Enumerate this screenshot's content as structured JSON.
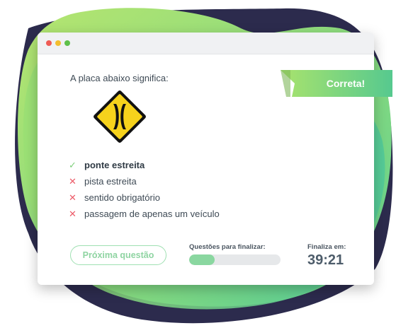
{
  "window": {
    "controls": [
      "close",
      "minimize",
      "maximize"
    ]
  },
  "quiz": {
    "question": "A placa abaixo significa:",
    "sign_icon": "narrow-bridge-sign-icon",
    "result_label": "Correta!",
    "options": [
      {
        "text": "ponte estreita",
        "status": "correct",
        "selected": true
      },
      {
        "text": "pista estreita",
        "status": "wrong",
        "selected": false
      },
      {
        "text": "sentido obrigatório",
        "status": "wrong",
        "selected": false
      },
      {
        "text": "passagem de apenas um veículo",
        "status": "wrong",
        "selected": false
      }
    ]
  },
  "footer": {
    "next_label": "Próxima questão",
    "progress_label": "Questões para finalizar:",
    "progress_fraction": 0.28,
    "timer_label": "Finaliza em:",
    "timer_value": "39:21"
  },
  "colors": {
    "accent_green": "#8ad7a0",
    "correct": "#7dcf7a",
    "wrong": "#ec5b68",
    "sign_yellow": "#f6d21c",
    "dark_blob": "#2b2a4a"
  }
}
